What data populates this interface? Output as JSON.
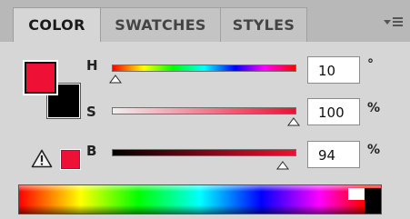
{
  "tabs": [
    {
      "label": "COLOR",
      "active": true
    },
    {
      "label": "SWATCHES",
      "active": false
    },
    {
      "label": "STYLES",
      "active": false
    }
  ],
  "menu_icon": "panel-menu-icon",
  "colors": {
    "foreground": "#ef1035",
    "background": "#000000",
    "gamut_swatch": "#ef1035"
  },
  "channels": {
    "h": {
      "label": "H",
      "value": "10",
      "unit": "°"
    },
    "s": {
      "label": "S",
      "value": "100",
      "unit": "%"
    },
    "b": {
      "label": "B",
      "value": "94",
      "unit": "%"
    }
  },
  "warning_icon": "out-of-gamut-warning-icon"
}
